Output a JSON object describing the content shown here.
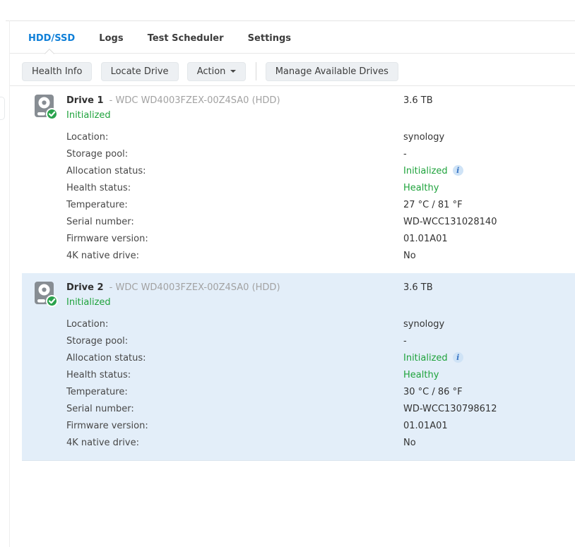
{
  "tabs": [
    {
      "label": "HDD/SSD",
      "active": true
    },
    {
      "label": "Logs",
      "active": false
    },
    {
      "label": "Test Scheduler",
      "active": false
    },
    {
      "label": "Settings",
      "active": false
    }
  ],
  "toolbar": {
    "health_info_label": "Health Info",
    "locate_drive_label": "Locate Drive",
    "action_label": "Action",
    "manage_label": "Manage Available Drives"
  },
  "icons": {
    "drive": "hdd-with-green-check-badge",
    "action_caret": "caret-down",
    "info": "i"
  },
  "colors": {
    "accent_blue": "#1080d8",
    "status_green": "#1fa33c",
    "selected_row_bg": "#e3eef9",
    "info_badge_bg": "#cfe3f6",
    "info_badge_fg": "#3b77c6"
  },
  "drives": [
    {
      "name": "Drive 1",
      "model": "- WDC WD4003FZEX-00Z4SA0 (HDD)",
      "size": "3.6 TB",
      "status": "Initialized",
      "selected": false,
      "details": [
        {
          "label": "Location:",
          "value": "synology"
        },
        {
          "label": "Storage pool:",
          "value": "-"
        },
        {
          "label": "Allocation status:",
          "value": "Initialized"
        },
        {
          "label": "Health status:",
          "value": "Healthy"
        },
        {
          "label": "Temperature:",
          "value": "27 °C / 81 °F"
        },
        {
          "label": "Serial number:",
          "value": "WD-WCC131028140"
        },
        {
          "label": "Firmware version:",
          "value": "01.01A01"
        },
        {
          "label": "4K native drive:",
          "value": "No"
        }
      ]
    },
    {
      "name": "Drive 2",
      "model": "- WDC WD4003FZEX-00Z4SA0 (HDD)",
      "size": "3.6 TB",
      "status": "Initialized",
      "selected": true,
      "details": [
        {
          "label": "Location:",
          "value": "synology"
        },
        {
          "label": "Storage pool:",
          "value": "-"
        },
        {
          "label": "Allocation status:",
          "value": "Initialized"
        },
        {
          "label": "Health status:",
          "value": "Healthy"
        },
        {
          "label": "Temperature:",
          "value": "30 °C / 86 °F"
        },
        {
          "label": "Serial number:",
          "value": "WD-WCC130798612"
        },
        {
          "label": "Firmware version:",
          "value": "01.01A01"
        },
        {
          "label": "4K native drive:",
          "value": "No"
        }
      ]
    }
  ]
}
